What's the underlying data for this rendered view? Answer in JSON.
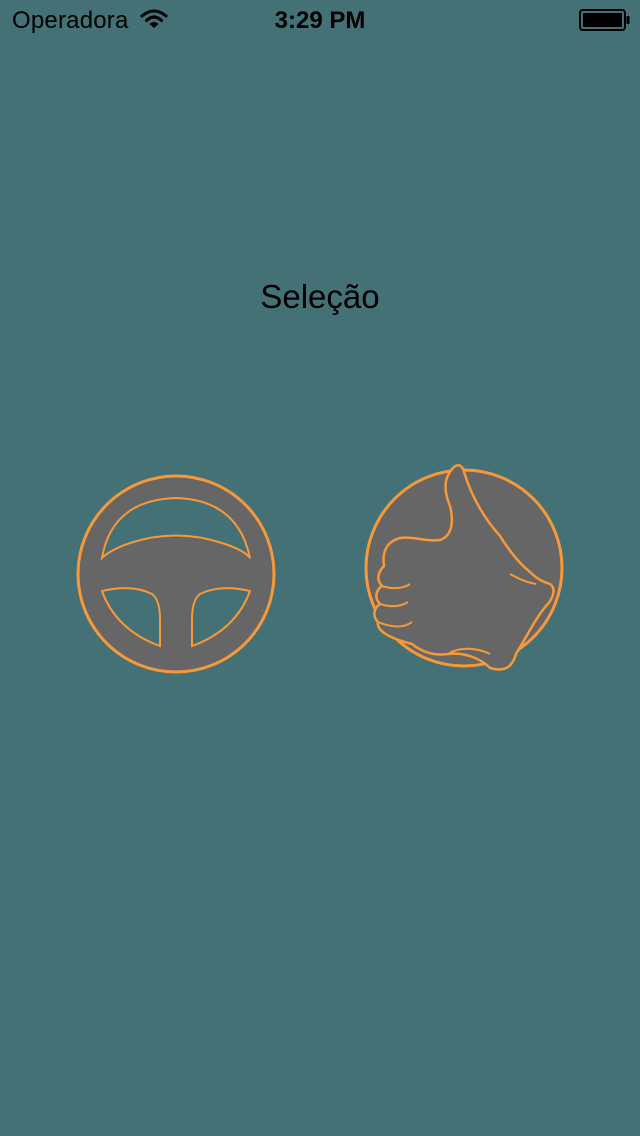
{
  "status_bar": {
    "carrier": "Operadora",
    "time": "3:29 PM",
    "wifi_icon": "wifi-icon",
    "battery_icon": "battery-full-icon"
  },
  "screen": {
    "title": "Seleção"
  },
  "options": [
    {
      "icon": "steering-wheel-icon"
    },
    {
      "icon": "thumbs-up-icon"
    }
  ],
  "colors": {
    "background": "#437175",
    "icon_fill": "#666666",
    "icon_stroke": "#F7993A",
    "text": "#000000"
  }
}
